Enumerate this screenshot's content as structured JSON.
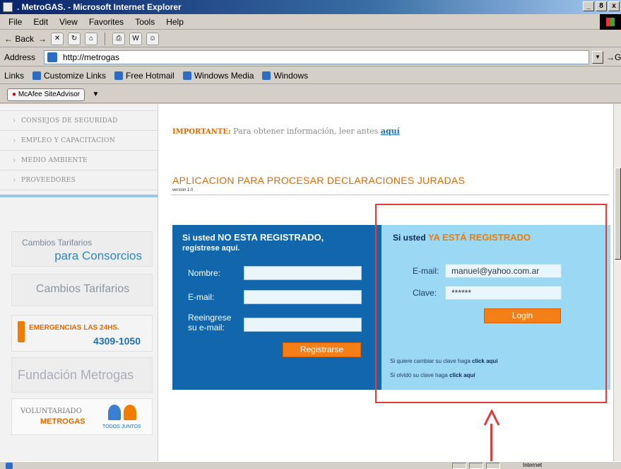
{
  "window": {
    "title": ". MetroGAS. - Microsoft Internet Explorer",
    "buttons": [
      "_",
      "8",
      "x"
    ]
  },
  "menubar": [
    "File",
    "Edit",
    "View",
    "Favorites",
    "Tools",
    "Help"
  ],
  "toolbar": {
    "back": "Back",
    "back_icon": "back-arrow-icon"
  },
  "addressbar": {
    "label": "Address",
    "url": "http://metrogas",
    "go": "Go"
  },
  "linksbar": {
    "label": "Links",
    "items": [
      "Customize Links",
      "Free Hotmail",
      "Windows Media",
      "Windows"
    ]
  },
  "mcafee": {
    "label": "McAfee SiteAdvisor"
  },
  "sidebar": {
    "items": [
      "CONSEJOS DE SEGURIDAD",
      "EMPLEO Y CAPACITACION",
      "MEDIO AMBIENTE",
      "PROVEEDORES"
    ],
    "banners": {
      "b1_line1": "Cambios Tarifarios",
      "b1_line2": "para Consorcios",
      "b2": "Cambios Tarifarios",
      "b3_line1": "EMERGENCIAS LAS 24HS.",
      "b3_line2": "4309-1050",
      "b4": "Fundación Metrogas",
      "b5_line1": "VOLUNTARIADO",
      "b5_line2": "METROGAS",
      "b5_line3": "TODOS JUNTOS"
    }
  },
  "main": {
    "notice_prefix": "IMPORTANTE:",
    "notice_text": "Para obtener información, leer antes",
    "notice_link": "aquí",
    "title": "APLICACION PARA PROCESAR DECLARACIONES JURADAS",
    "version": "version 1.0"
  },
  "register": {
    "heading_pre": "Si usted",
    "heading_strong": "NO ESTA REGISTRADO,",
    "heading_line2": "regístrese aquí.",
    "name_label": "Nombre:",
    "email_label": "E-mail:",
    "reenter_label_1": "Reeingrese",
    "reenter_label_2": "su e-mail:",
    "button": "Registrarse"
  },
  "login": {
    "heading_pre": "Si usted",
    "heading_strong": "YA ESTÁ REGISTRADO",
    "email_label": "E-mail:",
    "email_value": "manuel@yahoo.com.ar",
    "password_label": "Clave:",
    "password_value": "******",
    "button": "Login",
    "change_text": "Si quiere cambiar su clave haga",
    "change_link": "click aquí",
    "forgot_text": "Si olvidó su clave haga",
    "forgot_link": "click aquí"
  },
  "statusbar": {
    "zone": "Internet"
  },
  "colors": {
    "orange": "#f07c00",
    "blue_panel": "#1266ab",
    "light_panel": "#9bd8f4",
    "annotation": "#e53a3a"
  }
}
